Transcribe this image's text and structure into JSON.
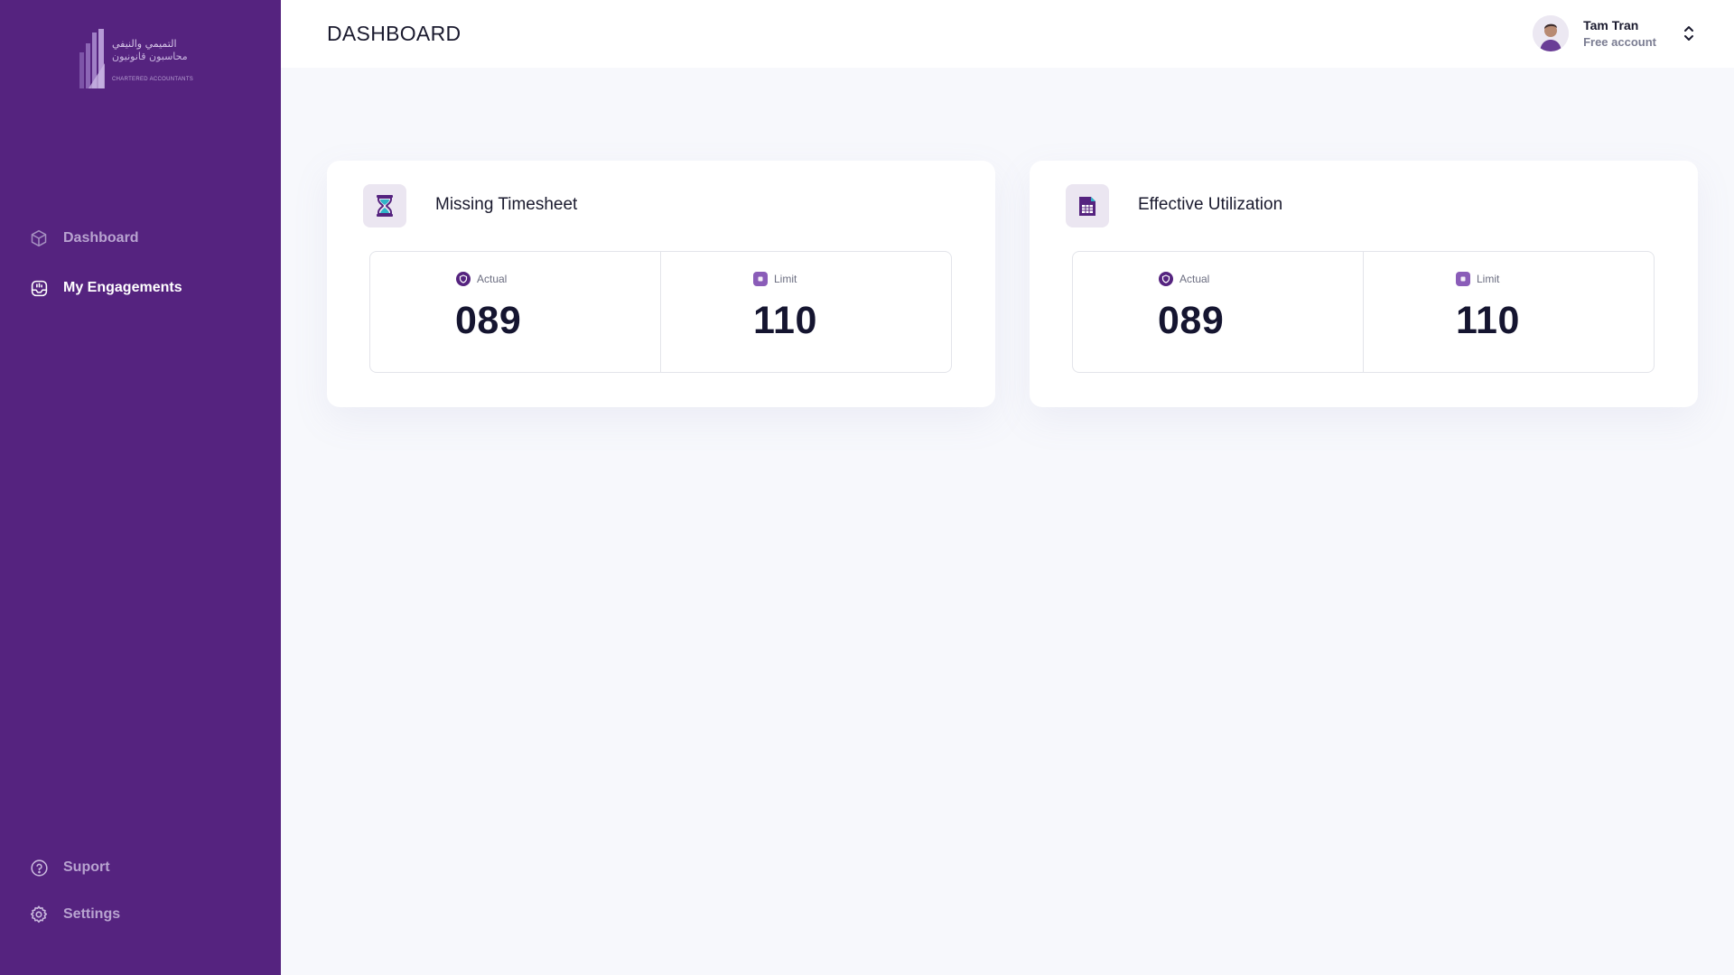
{
  "brand": {
    "logo_text_ar_line1": "التميمي والنيفي",
    "logo_text_ar_line2": "محاسبون قانونيون",
    "logo_text_en": "CHARTERED ACCOUNTANTS"
  },
  "sidebar": {
    "items": [
      {
        "label": "Dashboard",
        "icon": "cube-icon",
        "active": false
      },
      {
        "label": "My Engagements",
        "icon": "engagements-icon",
        "active": true
      }
    ],
    "bottom_items": [
      {
        "label": "Suport",
        "icon": "help-circle-icon"
      },
      {
        "label": "Settings",
        "icon": "gear-icon"
      }
    ]
  },
  "header": {
    "title": "DASHBOARD",
    "user": {
      "name": "Tam Tran",
      "plan": "Free account"
    }
  },
  "cards": [
    {
      "title": "Missing Timesheet",
      "icon": "hourglass-icon",
      "actual_label": "Actual",
      "actual_value": "089",
      "limit_label": "Limit",
      "limit_value": "110"
    },
    {
      "title": "Effective Utilization",
      "icon": "spreadsheet-icon",
      "actual_label": "Actual",
      "actual_value": "089",
      "limit_label": "Limit",
      "limit_value": "110"
    }
  ],
  "colors": {
    "sidebar_bg": "#55237f",
    "accent": "#8a5cb8",
    "background": "#f7f8fc"
  }
}
